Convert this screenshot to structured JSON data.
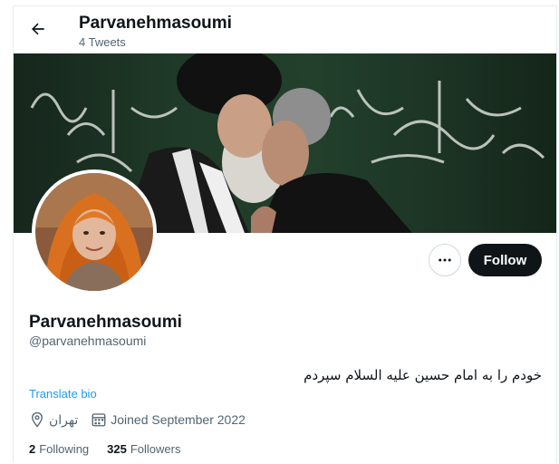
{
  "header": {
    "title": "Parvanehmasoumi",
    "subtitle": "4 Tweets"
  },
  "profile": {
    "name": "Parvanehmasoumi",
    "handle": "@parvanehmasoumi",
    "bio": "خودم را به امام حسین علیه السلام سپردم",
    "translate_label": "Translate bio",
    "location": "تهران",
    "joined": "Joined September 2022",
    "following_count": "2",
    "following_label": "Following",
    "followers_count": "325",
    "followers_label": "Followers"
  },
  "actions": {
    "follow_label": "Follow"
  },
  "icons": {
    "back": "back-arrow-icon",
    "more": "more-dots-icon",
    "location": "location-pin-icon",
    "calendar": "calendar-icon"
  },
  "colors": {
    "accent": "#1d9bf0",
    "follow_bg": "#0f1419",
    "secondary_text": "#536471"
  }
}
